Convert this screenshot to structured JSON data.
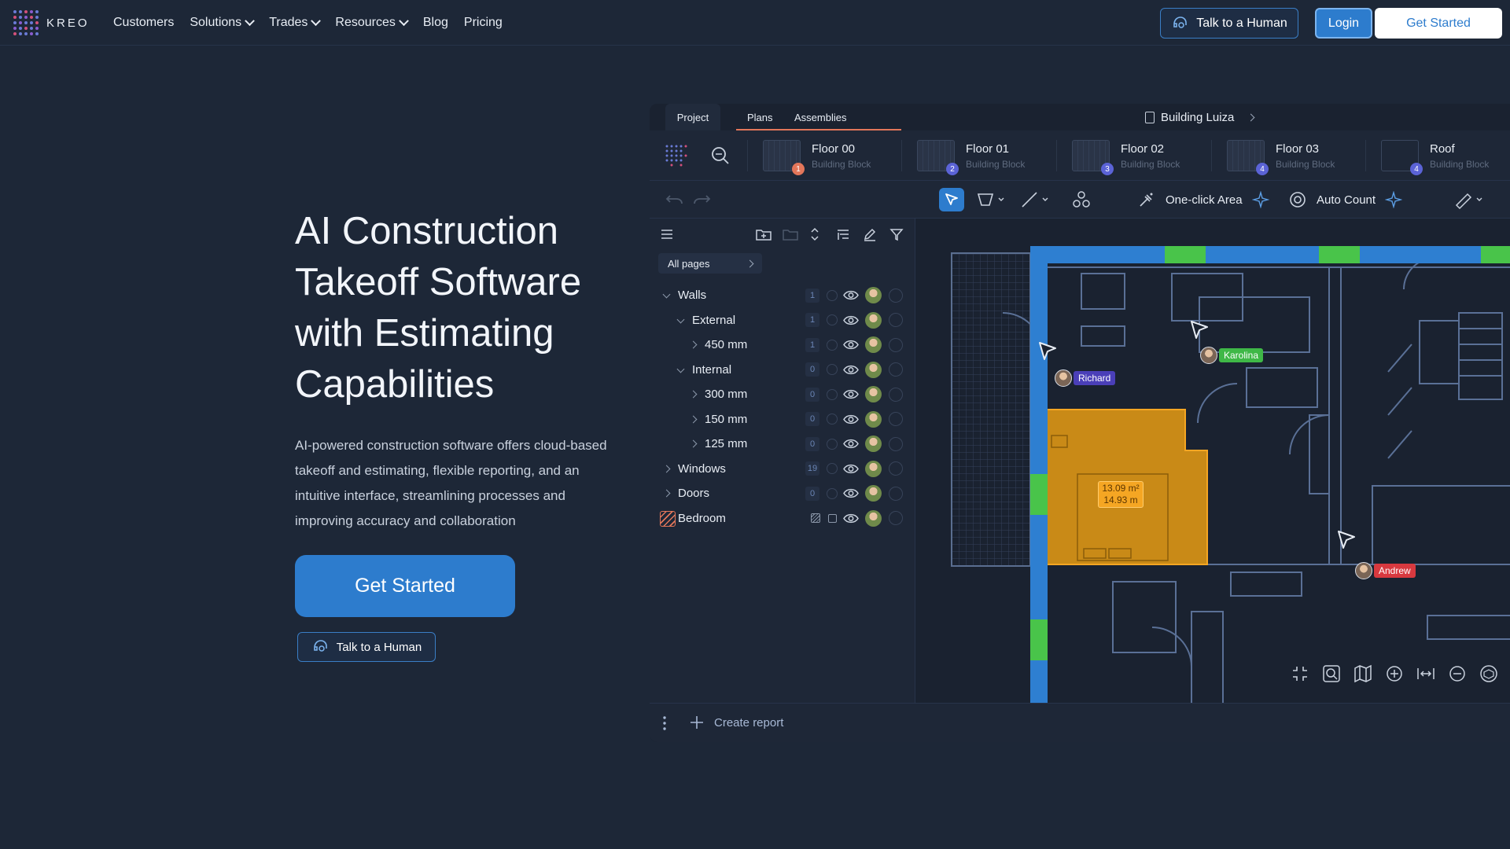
{
  "nav": {
    "logo_text": "KREO",
    "menu": [
      {
        "label": "Customers",
        "dropdown": false
      },
      {
        "label": "Solutions",
        "dropdown": true
      },
      {
        "label": "Trades",
        "dropdown": true
      },
      {
        "label": "Resources",
        "dropdown": true
      },
      {
        "label": "Blog",
        "dropdown": false
      },
      {
        "label": "Pricing",
        "dropdown": false
      }
    ],
    "talk_label": "Talk to a Human",
    "login_label": "Login",
    "start_label": "Get Started"
  },
  "hero": {
    "title": "AI Construction Takeoff Software with Estimating Capabilities",
    "description": "AI-powered construction software offers cloud-based takeoff and estimating, flexible reporting, and an intuitive interface, streamlining processes and improving accuracy and collaboration",
    "start_label": "Get Started",
    "talk_label": "Talk to a Human"
  },
  "app": {
    "tabs": {
      "project": "Project",
      "plans": "Plans",
      "assemblies": "Assemblies"
    },
    "building": "Building Luiza",
    "floors": [
      {
        "name": "Floor 00",
        "sub": "Building Block",
        "badge": "1",
        "badge_color": "#e3765a"
      },
      {
        "name": "Floor 01",
        "sub": "Building Block",
        "badge": "2",
        "badge_color": "#5b63d6"
      },
      {
        "name": "Floor 02",
        "sub": "Building Block",
        "badge": "3",
        "badge_color": "#5b63d6"
      },
      {
        "name": "Floor 03",
        "sub": "Building Block",
        "badge": "4",
        "badge_color": "#5b63d6"
      },
      {
        "name": "Roof",
        "sub": "Building Block",
        "badge": "4",
        "badge_color": "#5b63d6"
      }
    ],
    "toolbar": {
      "one_click_area": "One-click Area",
      "auto_count": "Auto Count"
    },
    "all_pages": "All pages",
    "tree": [
      {
        "label": "Walls",
        "count": "1",
        "level": 0,
        "expand": "down"
      },
      {
        "label": "External",
        "count": "1",
        "level": 1,
        "expand": "down"
      },
      {
        "label": "450 mm",
        "count": "1",
        "level": 2,
        "expand": "right"
      },
      {
        "label": "Internal",
        "count": "0",
        "level": 1,
        "expand": "down"
      },
      {
        "label": "300 mm",
        "count": "0",
        "level": 2,
        "expand": "right"
      },
      {
        "label": "150 mm",
        "count": "0",
        "level": 2,
        "expand": "right"
      },
      {
        "label": "125 mm",
        "count": "0",
        "level": 2,
        "expand": "right"
      },
      {
        "label": "Windows",
        "count": "19",
        "level": 0,
        "expand": "right"
      },
      {
        "label": "Doors",
        "count": "0",
        "level": 0,
        "expand": "right"
      },
      {
        "label": "Bedroom",
        "count": "",
        "level": 0,
        "expand": "none"
      }
    ],
    "create_report": "Create report",
    "area_label": {
      "line1": "13.09 m²",
      "line2": "14.93 m"
    },
    "users": [
      {
        "name": "Richard",
        "color": "#4a3fb8"
      },
      {
        "name": "Karolina",
        "color": "#3fb847"
      },
      {
        "name": "Andrew",
        "color": "#d8393f"
      }
    ]
  },
  "colors": {
    "background": "#1d2737",
    "accent": "#2d7ccd",
    "wall_blue": "#2e7fd1",
    "window_green": "#49c44a",
    "room_orange": "#c98a17"
  }
}
